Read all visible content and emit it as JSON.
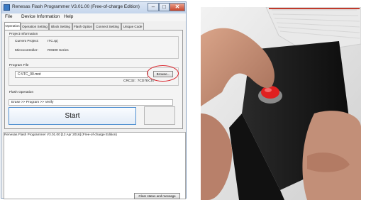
{
  "window": {
    "title": "Renesas Flash Programmer V3.01.00 (Free-of-charge Edition)",
    "controls": {
      "minimize": "–",
      "maximize": "□",
      "close": "✕"
    }
  },
  "menu": [
    "File",
    "Device Information",
    "Help"
  ],
  "tabs": [
    "Operation",
    "Operation Setting",
    "Block Setting",
    "Flash Option",
    "Connect Setting",
    "Unique Code"
  ],
  "project_information": {
    "label": "Project Information",
    "current_project_label": "Current Project:",
    "current_project_value": "ITC.rpj",
    "microcontroller_label": "Microcontroller:",
    "microcontroller_value": "RX600 Series"
  },
  "program_file": {
    "label": "Program File",
    "path": "C:\\ITC_00.mot",
    "browse_label": "Browse...",
    "crc": "CRC32 : 7CD7EC57"
  },
  "flash_operation": {
    "label": "Flash Operation",
    "sequence": "Erase >> Program >> Verify"
  },
  "start_label": "Start",
  "log_text": "Renesas Flash Programmer V3.01.00 [12 Apr 2016] (Free-of-charge Edition)",
  "clear_label": "Clear status and message",
  "accent_colors": {
    "highlight_ring": "#d9232a",
    "start_border": "#4f8fd0",
    "button_red": "#e02020"
  }
}
